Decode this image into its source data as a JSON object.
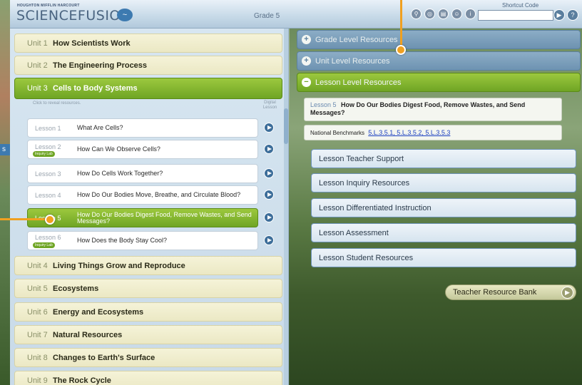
{
  "header": {
    "brand_small": "HOUGHTON MIFFLIN HARCOURT",
    "brand_main": "SCIENCEFUSION",
    "grade": "Grade 5",
    "shortcut_label": "Shortcut Code",
    "shortcut_value": "",
    "tool_icons": [
      "search-icon",
      "globe-icon",
      "document-icon",
      "people-icon",
      "info-icon"
    ]
  },
  "units": [
    {
      "num": "Unit 1",
      "title": "How Scientists Work"
    },
    {
      "num": "Unit 2",
      "title": "The Engineering Process"
    },
    {
      "num": "Unit 3",
      "title": "Cells to Body Systems"
    },
    {
      "num": "Unit 4",
      "title": "Living Things Grow and Reproduce"
    },
    {
      "num": "Unit 5",
      "title": "Ecosystems"
    },
    {
      "num": "Unit 6",
      "title": "Energy and Ecosystems"
    },
    {
      "num": "Unit 7",
      "title": "Natural Resources"
    },
    {
      "num": "Unit 8",
      "title": "Changes to Earth's Surface"
    },
    {
      "num": "Unit 9",
      "title": "The Rock Cycle"
    }
  ],
  "lessons_header": {
    "reveal": "Click to reveal resources.",
    "digital": "Digital Lesson"
  },
  "lessons": [
    {
      "num": "Lesson 1",
      "title": "What Are Cells?",
      "badge": ""
    },
    {
      "num": "Lesson 2",
      "title": "How Can We Observe Cells?",
      "badge": "Inquiry Lab"
    },
    {
      "num": "Lesson 3",
      "title": "How Do Cells Work Together?",
      "badge": ""
    },
    {
      "num": "Lesson 4",
      "title": "How Do Our Bodies Move, Breathe, and Circulate Blood?",
      "badge": ""
    },
    {
      "num": "Lesson 5",
      "title": "How Do Our Bodies Digest Food, Remove Wastes, and Send Messages?",
      "badge": ""
    },
    {
      "num": "Lesson 6",
      "title": "How Does the Body Stay Cool?",
      "badge": "Inquiry Lab"
    }
  ],
  "resources": {
    "grade_level": "Grade Level Resources",
    "unit_level": "Unit Level Resources",
    "lesson_level": "Lesson Level Resources",
    "lesson_num": "Lesson 5",
    "lesson_title": "How Do Our Bodies Digest Food, Remove Wastes, and Send Messages?",
    "benchmarks_label": "National Benchmarks",
    "benchmarks_links": "5.L.3.5.1, 5.L.3.5.2, 5.L.3.5.3",
    "items": [
      "Lesson Teacher Support",
      "Lesson Inquiry Resources",
      "Lesson Differentiated Instruction",
      "Lesson Assessment",
      "Lesson Student Resources"
    ],
    "teacher_bank": "Teacher Resource Bank"
  },
  "colors": {
    "active_green": "#6fa524",
    "unit_bg": "#f5f3d8",
    "resource_blue": "#6d93b8",
    "callout_orange": "#f0a020"
  }
}
